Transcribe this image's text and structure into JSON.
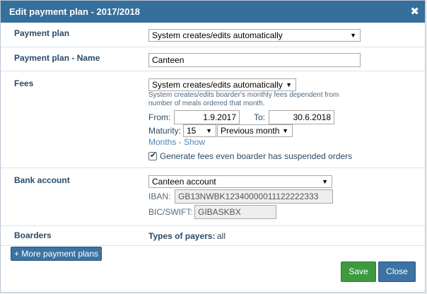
{
  "modal": {
    "title": "Edit payment plan - 2017/2018",
    "close_glyph": "✖"
  },
  "payment_plan": {
    "label": "Payment plan",
    "selected": "System creates/edits automatically"
  },
  "plan_name": {
    "label": "Payment plan - Name",
    "value": "Canteen"
  },
  "fees": {
    "label": "Fees",
    "mode_selected": "System creates/edits automatically",
    "help_line1": "System creates/edits boarder's monthly fees dependent from",
    "help_line2": "number of meals ordered that month.",
    "from_label": "From:",
    "from_value": "1.9.2017",
    "to_label": "To:",
    "to_value": "30.6.2018",
    "maturity_label": "Maturity:",
    "maturity_day": "15",
    "maturity_month": "Previous month",
    "months_link": "Months - Show",
    "generate_label": "Generate fees even boarder has suspended orders",
    "generate_checked": true
  },
  "bank": {
    "label": "Bank account",
    "selected": "Canteen account",
    "iban_label": "IBAN:",
    "iban_value": "GB13NWBK12340000011122222333",
    "bic_label": "BIC/SWIFT:",
    "bic_value": "GIBASKBX"
  },
  "boarders": {
    "label": "Boarders",
    "types_label": "Types of payers:",
    "types_value": "all"
  },
  "buttons": {
    "more_plans": "+ More payment plans",
    "save": "Save",
    "close": "Close"
  },
  "icons": {
    "dropdown_arrow": "▼"
  },
  "colors": {
    "title_bar": "#356f9c",
    "save_button": "#3e9a3e",
    "close_button": "#3b73a3"
  }
}
